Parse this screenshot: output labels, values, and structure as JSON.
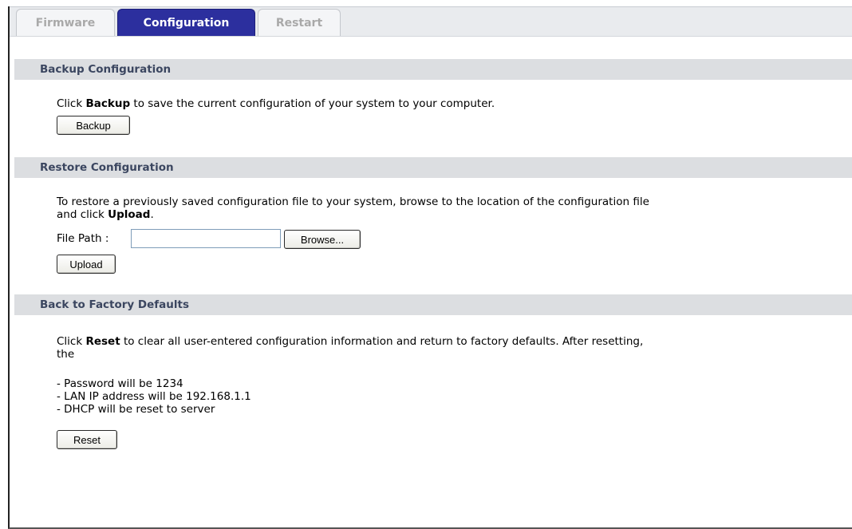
{
  "tabs": [
    {
      "label": "Firmware",
      "active": false
    },
    {
      "label": "Configuration",
      "active": true
    },
    {
      "label": "Restart",
      "active": false
    }
  ],
  "backup": {
    "header": "Backup Configuration",
    "text_pre": "Click ",
    "text_bold": "Backup",
    "text_post": " to save the current configuration of your system to your computer.",
    "button": "Backup"
  },
  "restore": {
    "header": "Restore Configuration",
    "text_line1": "To restore a previously saved configuration file to your system, browse to the location of the configuration file",
    "text_line2_pre": "and click ",
    "text_line2_bold": "Upload",
    "text_line2_post": ".",
    "file_path_label": "File Path :",
    "file_path_value": "",
    "browse_button": "Browse...",
    "upload_button": "Upload"
  },
  "factory": {
    "header": "Back to Factory Defaults",
    "text_pre": "Click ",
    "text_bold": "Reset",
    "text_post": " to clear all user-entered configuration information and return to factory defaults. After resetting,",
    "text_line2": "the",
    "items": [
      "- Password will be 1234",
      "- LAN IP address will be 192.168.1.1",
      "- DHCP will be reset to server"
    ],
    "reset_button": "Reset"
  },
  "colors": {
    "active_tab": "#2c2f9e",
    "section_header_bg": "#dcdee1",
    "section_header_text": "#3b4660"
  }
}
